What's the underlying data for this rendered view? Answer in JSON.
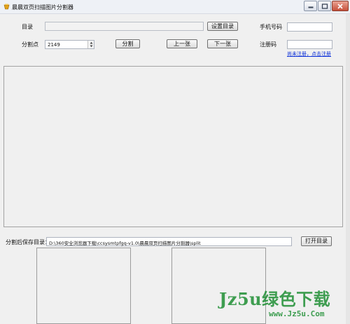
{
  "window": {
    "title": "晨晨双页扫描图片分割器",
    "buttons": [
      "minimize",
      "maximize",
      "close"
    ]
  },
  "form": {
    "directory_label": "目录",
    "directory_value": "",
    "set_directory_button": "设置目录",
    "split_point_label": "分割点",
    "split_point_value": "2149",
    "split_button": "分割",
    "prev_button": "上一张",
    "next_button": "下一张",
    "phone_label": "手机号码",
    "phone_value": "",
    "reg_code_label": "注册码",
    "reg_code_value": "",
    "register_link": "尚未注册，点击注册"
  },
  "output": {
    "save_dir_label": "分割后保存目录：",
    "save_dir_value": "D:\\360安全浏览器下载\\ccsysmtpfgq-v1.0\\晨晨双页扫描图片分割器\\split",
    "open_dir_button": "打开目录"
  },
  "watermark": {
    "main": "Jz5u绿色下载",
    "sub": "www.Jz5u.Com"
  },
  "colors": {
    "link": "#0b2fd8",
    "watermark": "#1f8f35",
    "background": "#f0f0f0"
  }
}
